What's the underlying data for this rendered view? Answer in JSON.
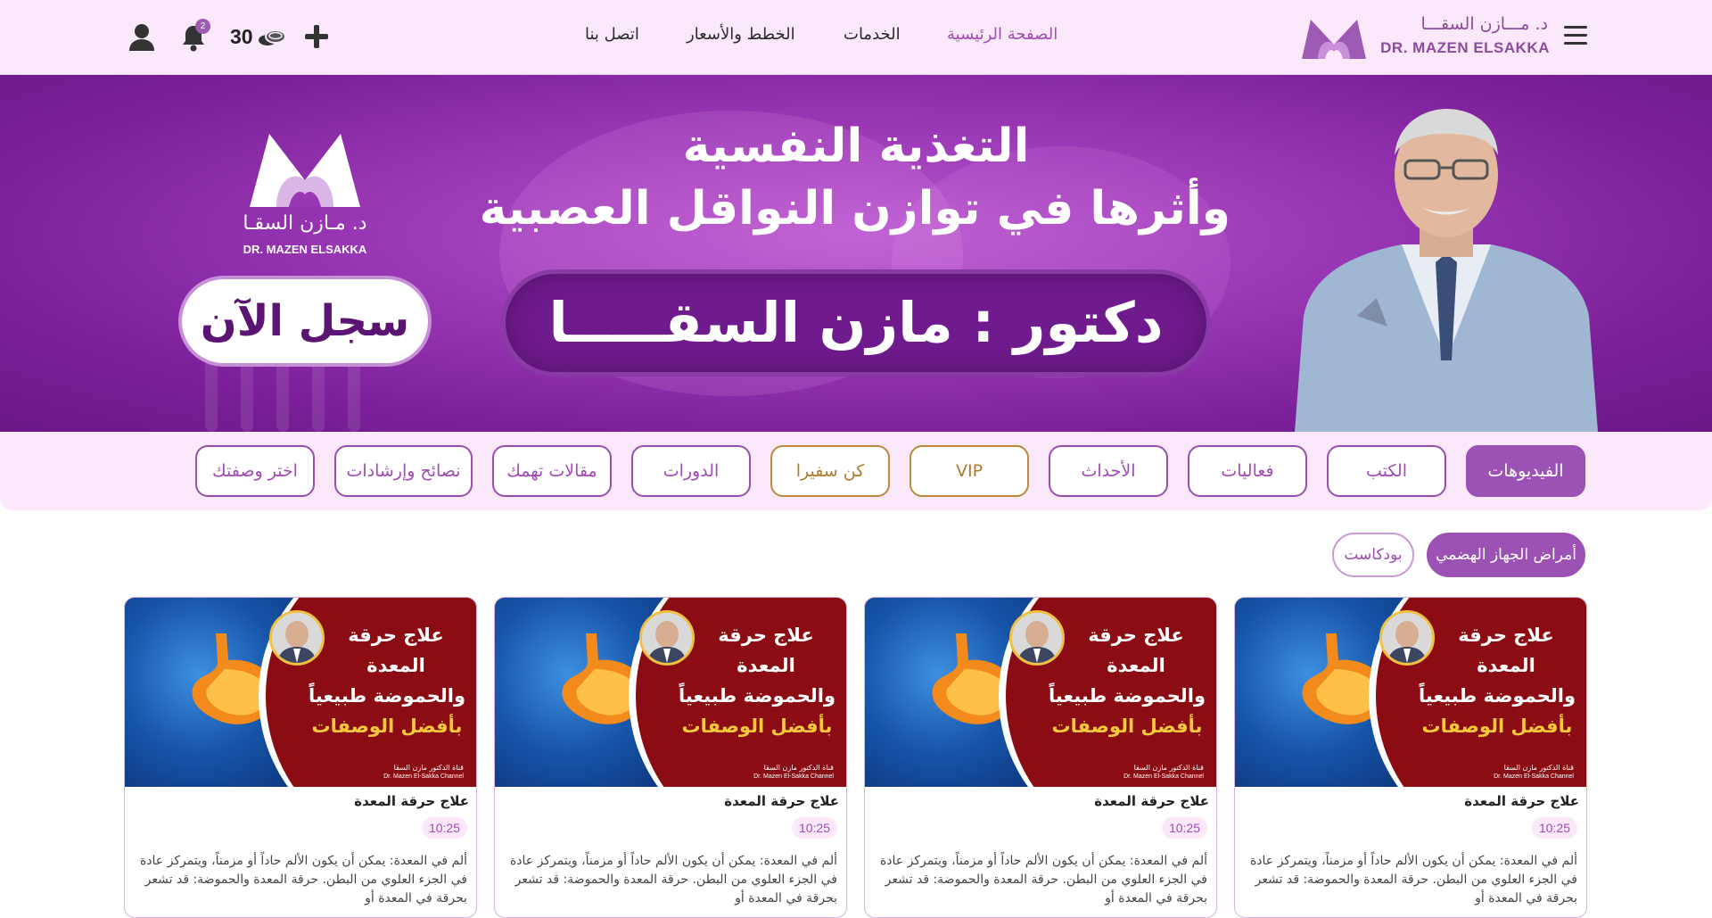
{
  "header": {
    "logo_ar": "د. مـــازن السقـــا",
    "logo_en": "DR. MAZEN ELSAKKA",
    "nav": [
      {
        "label": "الصفحة الرئيسية",
        "active": true
      },
      {
        "label": "الخدمات",
        "active": false
      },
      {
        "label": "الخطط والأسعار",
        "active": false
      },
      {
        "label": "اتصل بنا",
        "active": false
      }
    ],
    "coins": "30",
    "notifications_count": "2",
    "icons": [
      "menu-icon",
      "add-icon",
      "coins-icon",
      "bell-icon",
      "user-icon"
    ]
  },
  "hero": {
    "title_line1": "التغذية النفسية",
    "title_line2": "وأثرها في توازن النواقل العصبية",
    "name": "دكتور : مازن السقـــــا",
    "cta": "سجل الآن",
    "logo_ar": "د. مـازن السقـا",
    "logo_en": "DR. MAZEN ELSAKKA"
  },
  "categories": [
    {
      "label": "الفيديوهات",
      "active": true,
      "style": "purple"
    },
    {
      "label": "الكتب",
      "active": false,
      "style": "purple"
    },
    {
      "label": "فعاليات",
      "active": false,
      "style": "purple"
    },
    {
      "label": "الأحداث",
      "active": false,
      "style": "purple"
    },
    {
      "label": "VIP",
      "active": false,
      "style": "gold"
    },
    {
      "label": "كن سفيرا",
      "active": false,
      "style": "gold"
    },
    {
      "label": "الدورات",
      "active": false,
      "style": "purple"
    },
    {
      "label": "مقالات تهمك",
      "active": false,
      "style": "purple"
    },
    {
      "label": "نصائح وإرشادات",
      "active": false,
      "style": "purple"
    },
    {
      "label": "اختر وصفتك",
      "active": false,
      "style": "purple"
    }
  ],
  "sub_tabs": [
    {
      "label": "أمراض الجهاز الهضمي",
      "active": true
    },
    {
      "label": "بودكاست",
      "active": false
    }
  ],
  "videos": [
    {
      "thumb_lines": [
        "علاج حرقة",
        "المعدة",
        "والحموضة طبيعياً",
        "بأفضل الوصفات"
      ],
      "channel_ar": "قناة الدكتور مازن السقا",
      "channel_en": "Dr. Mazen El-Sakka Channel",
      "title": "علاج حرقة المعدة",
      "duration": "10:25",
      "desc": "ألم في المعدة: يمكن أن يكون الألم حاداً أو مزمناً، ويتمركز عادة في الجزء العلوي من البطن. حرقة المعدة والحموضة: قد تشعر بحرقة في المعدة أو"
    },
    {
      "thumb_lines": [
        "علاج حرقة",
        "المعدة",
        "والحموضة طبيعياً",
        "بأفضل الوصفات"
      ],
      "channel_ar": "قناة الدكتور مازن السقا",
      "channel_en": "Dr. Mazen El-Sakka Channel",
      "title": "علاج حرقة المعدة",
      "duration": "10:25",
      "desc": "ألم في المعدة: يمكن أن يكون الألم حاداً أو مزمناً، ويتمركز عادة في الجزء العلوي من البطن. حرقة المعدة والحموضة: قد تشعر بحرقة في المعدة أو"
    },
    {
      "thumb_lines": [
        "علاج حرقة",
        "المعدة",
        "والحموضة طبيعياً",
        "بأفضل الوصفات"
      ],
      "channel_ar": "قناة الدكتور مازن السقا",
      "channel_en": "Dr. Mazen El-Sakka Channel",
      "title": "علاج حرقة المعدة",
      "duration": "10:25",
      "desc": "ألم في المعدة: يمكن أن يكون الألم حاداً أو مزمناً، ويتمركز عادة في الجزء العلوي من البطن. حرقة المعدة والحموضة: قد تشعر بحرقة في المعدة أو"
    },
    {
      "thumb_lines": [
        "علاج حرقة",
        "المعدة",
        "والحموضة طبيعياً",
        "بأفضل الوصفات"
      ],
      "channel_ar": "قناة الدكتور مازن السقا",
      "channel_en": "Dr. Mazen El-Sakka Channel",
      "title": "علاج حرقة المعدة",
      "duration": "10:25",
      "desc": "ألم في المعدة: يمكن أن يكون الألم حاداً أو مزمناً، ويتمركز عادة في الجزء العلوي من البطن. حرقة المعدة والحموضة: قد تشعر بحرقة في المعدة أو"
    }
  ],
  "colors": {
    "brand": "#9c52b4",
    "navbar_bg": "#fbe9fb",
    "hero_bg": "#9a37b5",
    "gold": "#c08a3c",
    "thumb_red": "#8b0d13"
  }
}
